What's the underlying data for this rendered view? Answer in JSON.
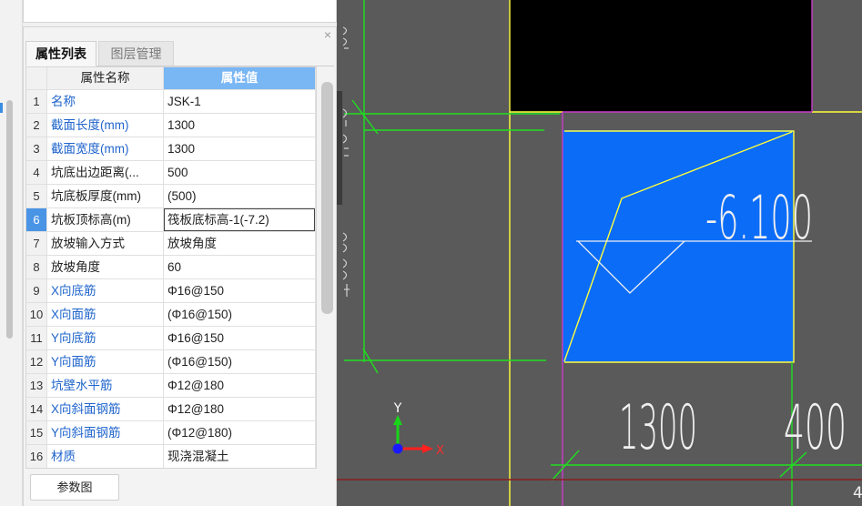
{
  "colors": {
    "canvas_bg": "#5a5a5a",
    "header_value_bg": "#79b6f4",
    "selected_row_bg": "#4a94e6",
    "name_blue": "#1f64cc",
    "cad_green": "#1fe01f",
    "cad_yellow": "#ffff3a",
    "cad_magenta": "#c93bc9",
    "cad_blue": "#0b6cf7",
    "cad_red": "#8a1c1c"
  },
  "panel": {
    "close_label": "×",
    "tabs": [
      {
        "label": "属性列表",
        "active": true
      },
      {
        "label": "图层管理",
        "active": false
      }
    ],
    "table": {
      "header_name": "属性名称",
      "header_value": "属性值",
      "rows": [
        {
          "num": "1",
          "name": "名称",
          "value": "JSK-1"
        },
        {
          "num": "2",
          "name": "截面长度(mm)",
          "value": "1300"
        },
        {
          "num": "3",
          "name": "截面宽度(mm)",
          "value": "1300"
        },
        {
          "num": "4",
          "name": "坑底出边距离(...",
          "value": "500"
        },
        {
          "num": "5",
          "name": "坑底板厚度(mm)",
          "value": "(500)"
        },
        {
          "num": "6",
          "name": "坑板顶标高(m)",
          "value": "筏板底标高-1(-7.2)",
          "selected": true
        },
        {
          "num": "7",
          "name": "放坡输入方式",
          "value": "放坡角度"
        },
        {
          "num": "8",
          "name": "放坡角度",
          "value": "60"
        },
        {
          "num": "9",
          "name": "X向底筋",
          "value": "Φ16@150"
        },
        {
          "num": "10",
          "name": "X向面筋",
          "value": "(Φ16@150)"
        },
        {
          "num": "11",
          "name": "Y向底筋",
          "value": "Φ16@150"
        },
        {
          "num": "12",
          "name": "Y向面筋",
          "value": "(Φ16@150)"
        },
        {
          "num": "13",
          "name": "坑壁水平筋",
          "value": "Φ12@180"
        },
        {
          "num": "14",
          "name": "X向斜面钢筋",
          "value": "Φ12@180"
        },
        {
          "num": "15",
          "name": "Y向斜面钢筋",
          "value": "(Φ12@180)"
        },
        {
          "num": "16",
          "name": "材质",
          "value": "现浇混凝土"
        }
      ]
    },
    "button_label": "参数图"
  },
  "canvas": {
    "elevation_text": "-6.100",
    "dimension_1": "1300",
    "dimension_2": "400",
    "edge_number": "4",
    "axis_x_label": "X",
    "axis_y_label": "Y"
  }
}
